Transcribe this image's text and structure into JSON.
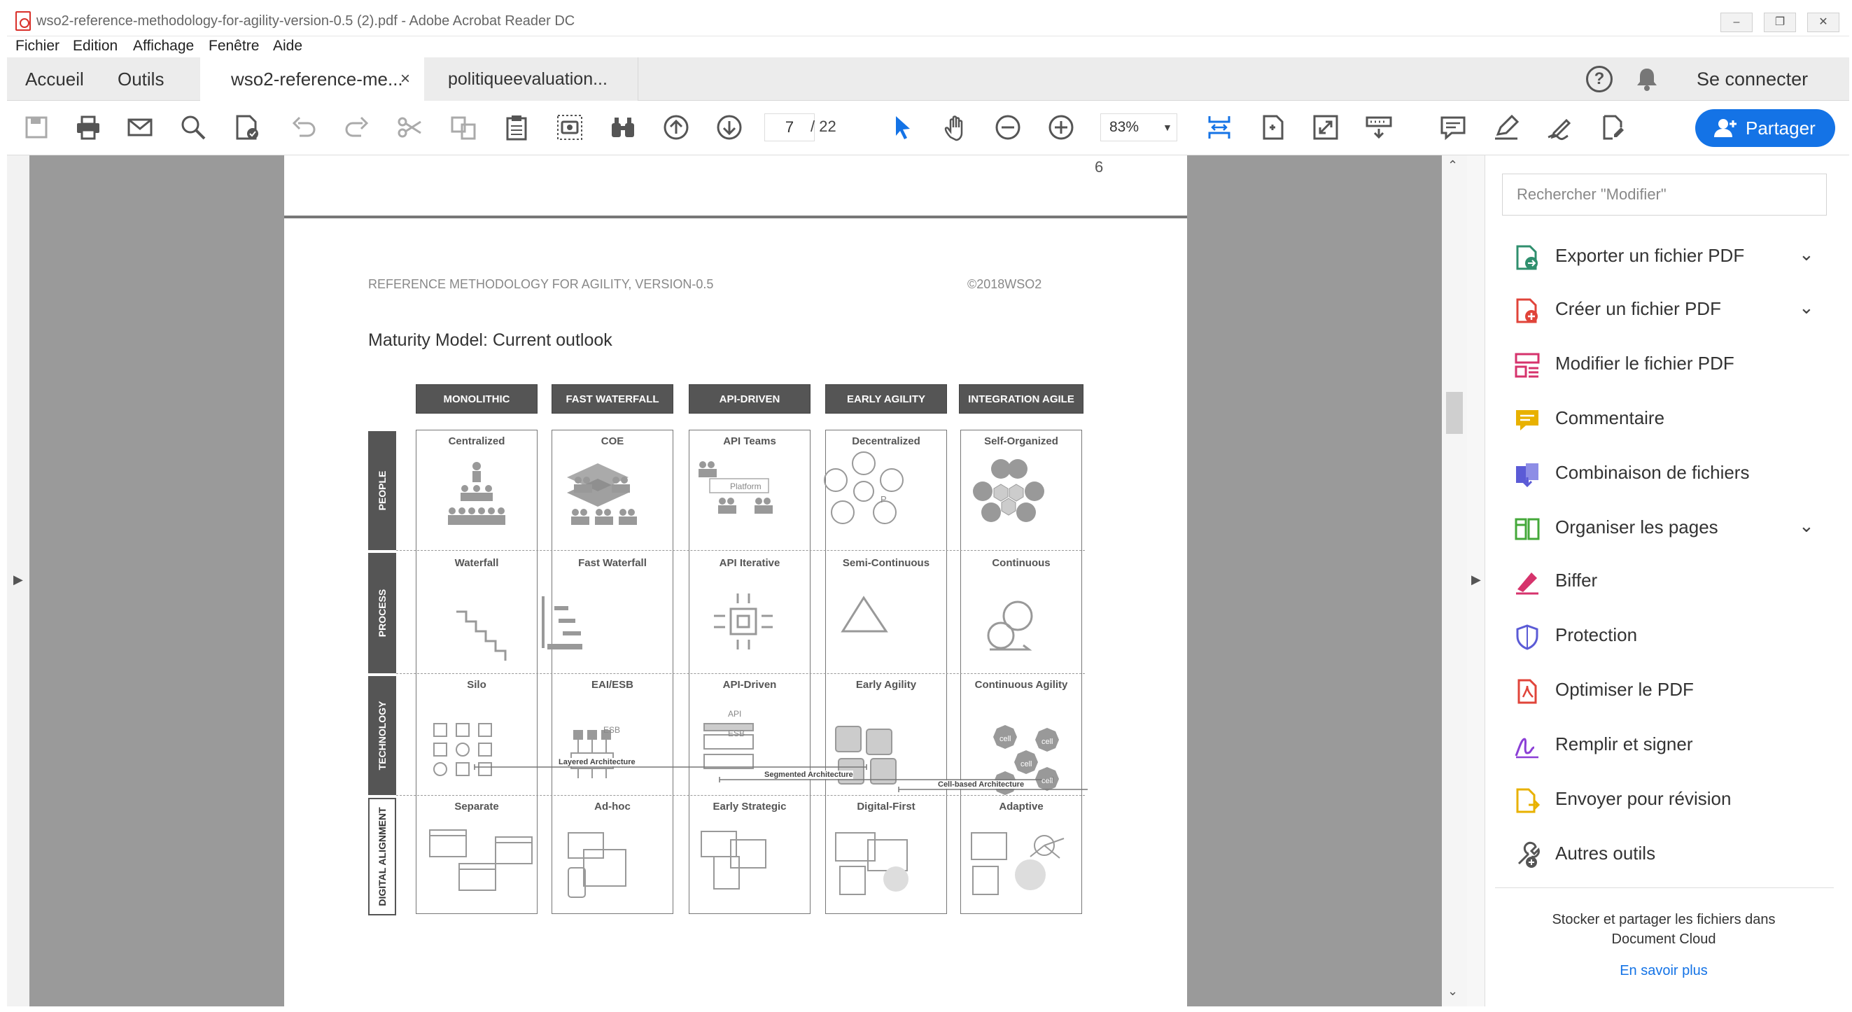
{
  "window": {
    "title": "wso2-reference-methodology-for-agility-version-0.5 (2).pdf - Adobe Acrobat Reader DC"
  },
  "menu": [
    "Fichier",
    "Edition",
    "Affichage",
    "Fenêtre",
    "Aide"
  ],
  "tabs": {
    "home": "Accueil",
    "tools": "Outils",
    "doc1": "wso2-reference-me...",
    "doc1_close": "×",
    "doc2": "politiqueevaluation..."
  },
  "header": {
    "signin": "Se connecter"
  },
  "toolbar": {
    "page_current": "7",
    "page_total": "/ 22",
    "zoom": "83%",
    "share": "Partager"
  },
  "document": {
    "prev_page_number": "6",
    "running_header_left": "REFERENCE METHODOLOGY FOR AGILITY, VERSION-0.5",
    "running_header_right": "©2018WSO2",
    "heading": "Maturity Model: Current outlook",
    "columns": [
      "MONOLITHIC",
      "FAST WATERFALL",
      "API-DRIVEN",
      "EARLY AGILITY",
      "INTEGRATION AGILE"
    ],
    "rows": [
      "PEOPLE",
      "PROCESS",
      "TECHNOLOGY",
      "DIGITAL ALIGNMENT"
    ],
    "cells": {
      "people": [
        "Centralized",
        "COE",
        "API Teams",
        "Decentralized",
        "Self-Organized"
      ],
      "process": [
        "Waterfall",
        "Fast Waterfall",
        "API Iterative",
        "Semi-Continuous",
        "Continuous"
      ],
      "technology": [
        "Silo",
        "EAI/ESB",
        "API-Driven",
        "Early Agility",
        "Continuous Agility"
      ],
      "digital": [
        "Separate",
        "Ad-hoc",
        "Early Strategic",
        "Digital-First",
        "Adaptive"
      ]
    },
    "arch_labels": [
      "Layered Architecture",
      "Segmented Architecture",
      "Cell-based Architecture"
    ],
    "inner_labels": {
      "platform": "Platform",
      "esb": "ESB",
      "api": "API",
      "p": "P",
      "cell": "cell"
    }
  },
  "right_panel": {
    "search_placeholder": "Rechercher \"Modifier\"",
    "tools": [
      {
        "label": "Exporter un fichier PDF",
        "icon": "export-pdf-icon",
        "color": "#2f8f6e",
        "expandable": true
      },
      {
        "label": "Créer un fichier PDF",
        "icon": "create-pdf-icon",
        "color": "#e0443a",
        "expandable": true
      },
      {
        "label": "Modifier le fichier PDF",
        "icon": "edit-pdf-icon",
        "color": "#d6336c",
        "expandable": false
      },
      {
        "label": "Commentaire",
        "icon": "comment-icon",
        "color": "#e8b100",
        "expandable": false
      },
      {
        "label": "Combinaison de fichiers",
        "icon": "combine-files-icon",
        "color": "#5b5bd6",
        "expandable": false
      },
      {
        "label": "Organiser les pages",
        "icon": "organize-pages-icon",
        "color": "#44a83a",
        "expandable": true
      },
      {
        "label": "Biffer",
        "icon": "redact-icon",
        "color": "#d6336c",
        "expandable": false
      },
      {
        "label": "Protection",
        "icon": "shield-icon",
        "color": "#5b5bd6",
        "expandable": false
      },
      {
        "label": "Optimiser le PDF",
        "icon": "optimize-pdf-icon",
        "color": "#e0443a",
        "expandable": false
      },
      {
        "label": "Remplir et signer",
        "icon": "fill-sign-icon",
        "color": "#8b3fd6",
        "expandable": false
      },
      {
        "label": "Envoyer pour révision",
        "icon": "send-review-icon",
        "color": "#e8b100",
        "expandable": false
      },
      {
        "label": "Autres outils",
        "icon": "more-tools-icon",
        "color": "#555555",
        "expandable": false
      }
    ],
    "cloud_text": "Stocker et partager les fichiers dans Document Cloud",
    "learn_more": "En savoir plus"
  },
  "colors": {
    "accent": "#1473e6",
    "viewer_bg": "#9a9a9a",
    "matrix_header": "#555555"
  }
}
